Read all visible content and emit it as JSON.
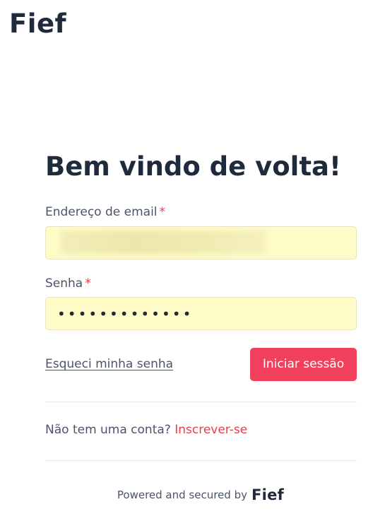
{
  "brand": {
    "logo_text": "Fief"
  },
  "login": {
    "heading": "Bem vindo de volta!",
    "email": {
      "label": "Endereço de email",
      "required_mark": "*",
      "value": ""
    },
    "password": {
      "label": "Senha",
      "required_mark": "*",
      "value": "•••••••••••••"
    },
    "forgot_password_label": "Esqueci minha senha",
    "submit_label": "Iniciar sessão"
  },
  "signup": {
    "prompt": "Não tem uma conta?",
    "link_label": "Inscrever-se"
  },
  "footer": {
    "powered_text": "Powered and secured by",
    "logo_text": "Fief"
  },
  "colors": {
    "accent": "#f0405e",
    "autofill_background": "#fefbc6",
    "text_dark": "#1f2a3c"
  }
}
